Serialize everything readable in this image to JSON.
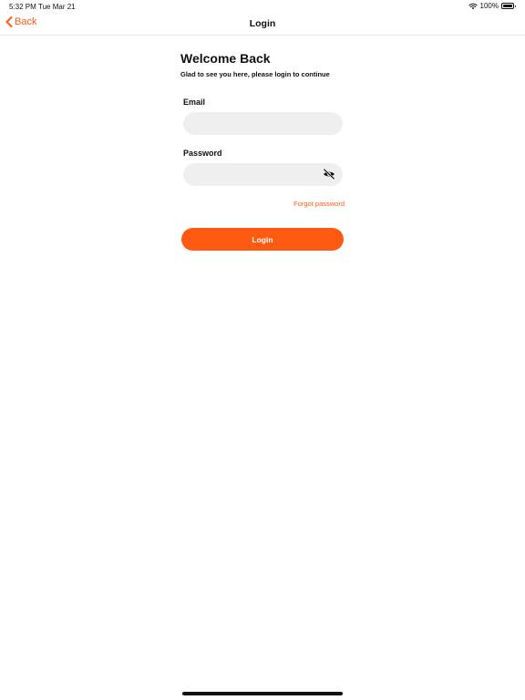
{
  "status_bar": {
    "time": "5:32 PM",
    "date": "Tue Mar 21",
    "battery": "100%",
    "wifi_icon": "wifi-icon",
    "battery_icon": "battery-full-icon"
  },
  "nav": {
    "back_label": "Back",
    "back_icon": "chevron-left-icon",
    "title": "Login"
  },
  "form": {
    "title": "Welcome Back",
    "subtitle": "Glad to see you here, please login to continue",
    "email_label": "Email",
    "email_value": "",
    "password_label": "Password",
    "password_value": "",
    "password_toggle_icon": "eye-off-icon",
    "forgot_label": "Forgot password",
    "login_label": "Login"
  },
  "colors": {
    "accent": "#ff5a12",
    "input_bg": "#efefef",
    "text": "#111111"
  }
}
